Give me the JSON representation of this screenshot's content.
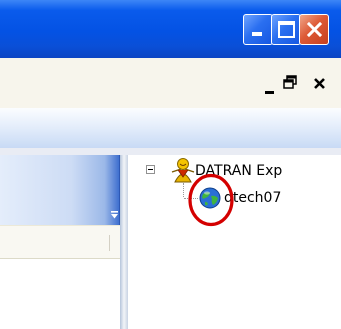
{
  "window": {
    "controls": [
      {
        "name": "minimize",
        "icon": "minimize-icon"
      },
      {
        "name": "maximize",
        "icon": "maximize-icon"
      },
      {
        "name": "close",
        "icon": "close-icon"
      }
    ],
    "mdi_controls": [
      {
        "name": "minimize",
        "icon": "minimize-icon"
      },
      {
        "name": "restore",
        "icon": "restore-icon"
      },
      {
        "name": "close",
        "icon": "close-icon"
      }
    ]
  },
  "colors": {
    "titlebar": "#0452e4",
    "close_button": "#dd5a36",
    "highlight_ring": "#d40000"
  },
  "tree": {
    "root": {
      "label": "DATRAN Exp",
      "icon": "datran-app-icon",
      "expanded": true
    },
    "children": [
      {
        "label": "dtech07",
        "icon": "globe-network-icon",
        "highlighted": true
      }
    ]
  }
}
